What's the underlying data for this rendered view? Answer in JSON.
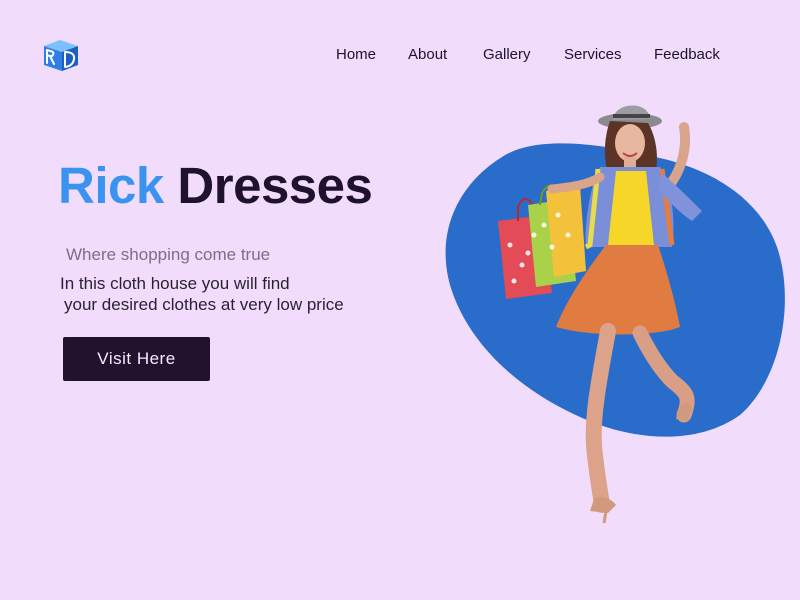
{
  "nav": {
    "items": [
      {
        "label": "Home"
      },
      {
        "label": "About"
      },
      {
        "label": "Gallery"
      },
      {
        "label": "Services"
      },
      {
        "label": "Feedback"
      }
    ]
  },
  "hero": {
    "title_accent": "Rick",
    "title_rest": "Dresses",
    "tagline": "Where shopping come true",
    "description_line1": "In this cloth house you will find",
    "description_line2": "your desired clothes at very low price",
    "cta_label": "Visit Here"
  },
  "colors": {
    "background": "#f2dcfb",
    "accent": "#3b93f0",
    "dark": "#1f1230",
    "button": "#23122e",
    "blob": "#2a6cc9"
  },
  "icons": {
    "logo": "rd-cube-logo-icon",
    "illustration": "woman-with-shopping-bags-illustration"
  }
}
